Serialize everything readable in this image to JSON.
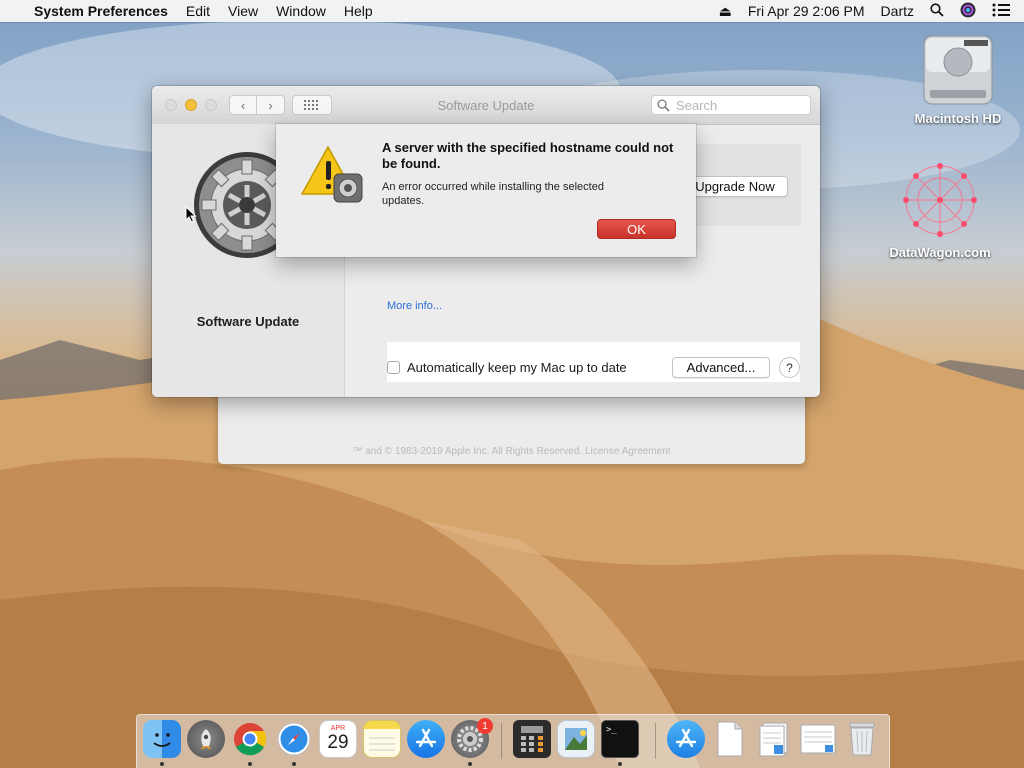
{
  "menubar": {
    "apple_icon": "apple-icon",
    "app_name": "System Preferences",
    "menus": [
      "Edit",
      "View",
      "Window",
      "Help"
    ],
    "right": {
      "datetime": "Fri Apr 29  2:06 PM",
      "user": "Dartz"
    }
  },
  "desktop_icons": [
    {
      "label": "Macintosh HD",
      "icon": "hard-drive-icon"
    },
    {
      "label": "DataWagon.com",
      "icon": "network-graphic-icon"
    }
  ],
  "window": {
    "title": "Software Update",
    "search_placeholder": "Search",
    "pane_label": "Software Update",
    "upgrade_button": "Upgrade Now",
    "more_info": "More info...",
    "auto_update_label": "Automatically keep my Mac up to date",
    "auto_update_checked": false,
    "advanced_button": "Advanced...",
    "help_button": "?"
  },
  "background_window": {
    "copyright": "™ and © 1983-2019 Apple Inc. All Rights Reserved. License Agreement"
  },
  "alert": {
    "title": "A server with the specified hostname could not be found.",
    "message": "An error occurred while installing the selected updates.",
    "ok_button": "OK",
    "icon": "warning-icon"
  },
  "dock": {
    "items": [
      {
        "name": "finder",
        "running": true
      },
      {
        "name": "launchpad",
        "running": false
      },
      {
        "name": "chrome",
        "running": true
      },
      {
        "name": "safari",
        "running": true
      },
      {
        "name": "calendar",
        "running": false,
        "month": "APR",
        "day": "29"
      },
      {
        "name": "notes",
        "running": false
      },
      {
        "name": "app-store",
        "running": false
      },
      {
        "name": "system-preferences",
        "running": true,
        "badge": "1"
      },
      {
        "name": "calculator",
        "running": false
      },
      {
        "name": "preview",
        "running": false
      },
      {
        "name": "terminal",
        "running": true
      },
      {
        "name": "applications-folder",
        "running": false
      },
      {
        "name": "document",
        "running": false
      },
      {
        "name": "document-stack",
        "running": false
      },
      {
        "name": "document-stack-2",
        "running": false
      },
      {
        "name": "trash",
        "running": false
      }
    ]
  },
  "colors": {
    "accent_link": "#2a6fd6",
    "ok_button": "#d63d33",
    "badge": "#f13a30"
  }
}
